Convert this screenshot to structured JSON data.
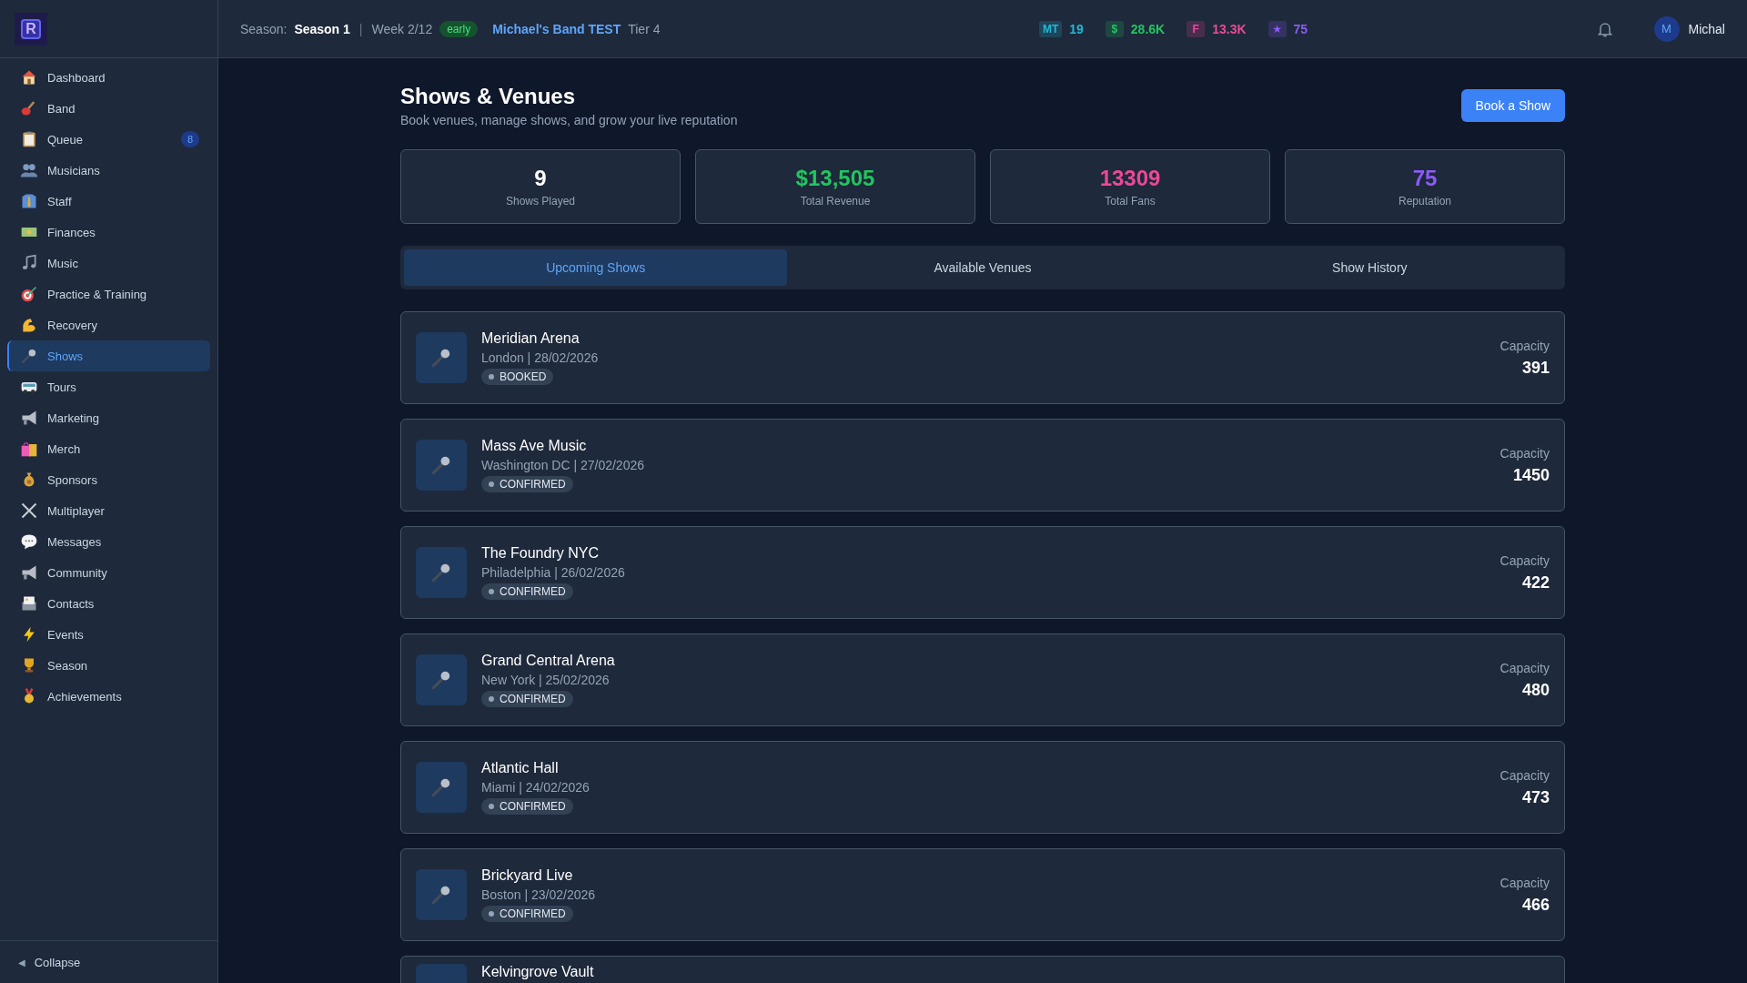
{
  "logo": {
    "letter": "R"
  },
  "sidebar": {
    "items": [
      {
        "label": "Dashboard",
        "selected": false
      },
      {
        "label": "Band",
        "selected": false
      },
      {
        "label": "Queue",
        "selected": false,
        "badge": "8"
      },
      {
        "label": "Musicians",
        "selected": false
      },
      {
        "label": "Staff",
        "selected": false
      },
      {
        "label": "Finances",
        "selected": false
      },
      {
        "label": "Music",
        "selected": false
      },
      {
        "label": "Practice & Training",
        "selected": false
      },
      {
        "label": "Recovery",
        "selected": false
      },
      {
        "label": "Shows",
        "selected": true
      },
      {
        "label": "Tours",
        "selected": false
      },
      {
        "label": "Marketing",
        "selected": false
      },
      {
        "label": "Merch",
        "selected": false
      },
      {
        "label": "Sponsors",
        "selected": false
      },
      {
        "label": "Multiplayer",
        "selected": false
      },
      {
        "label": "Messages",
        "selected": false
      },
      {
        "label": "Community",
        "selected": false
      },
      {
        "label": "Contacts",
        "selected": false
      },
      {
        "label": "Events",
        "selected": false
      },
      {
        "label": "Season",
        "selected": false
      },
      {
        "label": "Achievements",
        "selected": false
      }
    ],
    "collapse": {
      "arrow": "◀",
      "label": "Collapse"
    }
  },
  "topbar": {
    "season_label": "Season:",
    "season": "Season 1",
    "separator": "|",
    "week": "Week 2/12",
    "phase": "early",
    "band": "Michael's Band TEST",
    "tier": "Tier 4",
    "stats": [
      {
        "tag": "MT",
        "value": "19",
        "color": "#22b8d6"
      },
      {
        "tag": "$",
        "value": "28.6K",
        "color": "#22c55e"
      },
      {
        "tag": "F",
        "value": "13.3K",
        "color": "#ec4899"
      },
      {
        "tag": "★",
        "value": "75",
        "color": "#8b5cf6"
      }
    ],
    "user": {
      "initial": "M",
      "name": "Michal"
    }
  },
  "page": {
    "title": "Shows & Venues",
    "subtitle": "Book venues, manage shows, and grow your live reputation",
    "action": "Book a Show"
  },
  "summary": [
    {
      "value": "9",
      "label": "Shows Played",
      "color": "#ffffff"
    },
    {
      "value": "$13,505",
      "label": "Total Revenue",
      "color": "#22c55e"
    },
    {
      "value": "13309",
      "label": "Total Fans",
      "color": "#ec4899"
    },
    {
      "value": "75",
      "label": "Reputation",
      "color": "#8b5cf6"
    }
  ],
  "tabs": [
    {
      "label": "Upcoming Shows",
      "selected": true
    },
    {
      "label": "Available Venues",
      "selected": false
    },
    {
      "label": "Show History",
      "selected": false
    }
  ],
  "shows": [
    {
      "venue": "Meridian Arena",
      "details": "London | 28/02/2026",
      "status": "BOOKED",
      "capacity_label": "Capacity",
      "capacity": "391"
    },
    {
      "venue": "Mass Ave Music",
      "details": "Washington DC | 27/02/2026",
      "status": "CONFIRMED",
      "capacity_label": "Capacity",
      "capacity": "1450"
    },
    {
      "venue": "The Foundry NYC",
      "details": "Philadelphia | 26/02/2026",
      "status": "CONFIRMED",
      "capacity_label": "Capacity",
      "capacity": "422"
    },
    {
      "venue": "Grand Central Arena",
      "details": "New York | 25/02/2026",
      "status": "CONFIRMED",
      "capacity_label": "Capacity",
      "capacity": "480"
    },
    {
      "venue": "Atlantic Hall",
      "details": "Miami | 24/02/2026",
      "status": "CONFIRMED",
      "capacity_label": "Capacity",
      "capacity": "473"
    },
    {
      "venue": "Brickyard Live",
      "details": "Boston | 23/02/2026",
      "status": "CONFIRMED",
      "capacity_label": "Capacity",
      "capacity": "466"
    },
    {
      "venue": "Kelvingrove Vault"
    }
  ]
}
